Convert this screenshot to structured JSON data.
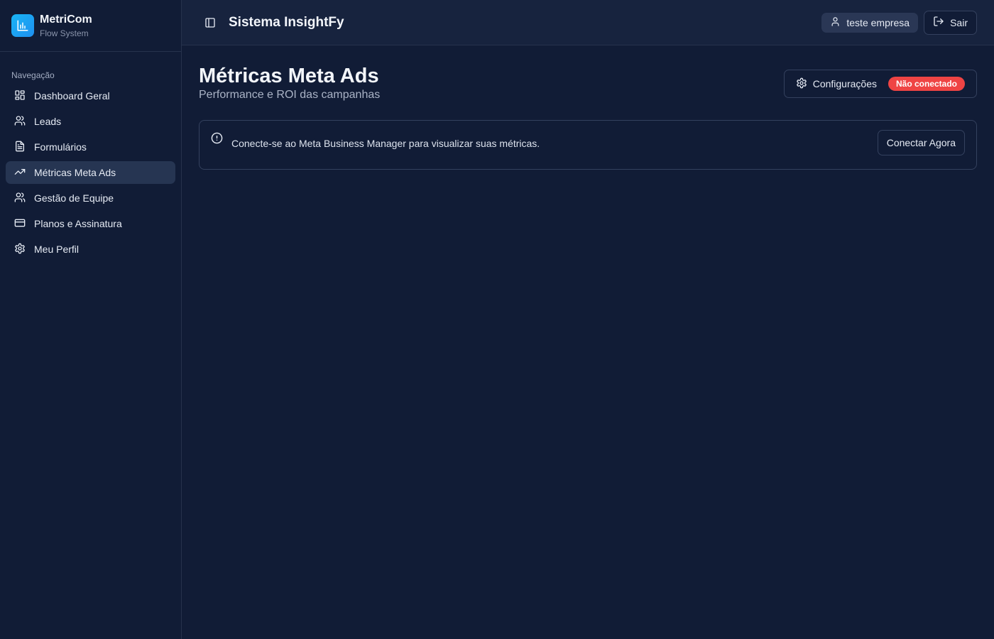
{
  "brand": {
    "name": "MetriCom",
    "subtitle": "Flow System"
  },
  "sidebar": {
    "heading": "Navegação",
    "items": [
      {
        "label": "Dashboard Geral",
        "icon": "layout-grid-icon",
        "active": false
      },
      {
        "label": "Leads",
        "icon": "users-icon",
        "active": false
      },
      {
        "label": "Formulários",
        "icon": "file-text-icon",
        "active": false
      },
      {
        "label": "Métricas Meta Ads",
        "icon": "trending-up-icon",
        "active": true
      },
      {
        "label": "Gestão de Equipe",
        "icon": "users-icon",
        "active": false
      },
      {
        "label": "Planos e Assinatura",
        "icon": "credit-card-icon",
        "active": false
      },
      {
        "label": "Meu Perfil",
        "icon": "gear-icon",
        "active": false
      }
    ]
  },
  "header": {
    "title": "Sistema InsightFy",
    "user": "teste empresa",
    "logout_label": "Sair"
  },
  "page": {
    "title": "Métricas Meta Ads",
    "subtitle": "Performance e ROI das campanhas",
    "config_label": "Configurações",
    "status_badge": "Não conectado"
  },
  "alert": {
    "message": "Conecte-se ao Meta Business Manager para visualizar suas métricas.",
    "button_label": "Conectar Agora"
  },
  "colors": {
    "background": "#111c36",
    "topbar": "#17233e",
    "active_item": "#263552",
    "accent": "#1ea6f5",
    "danger": "#ef4444"
  }
}
